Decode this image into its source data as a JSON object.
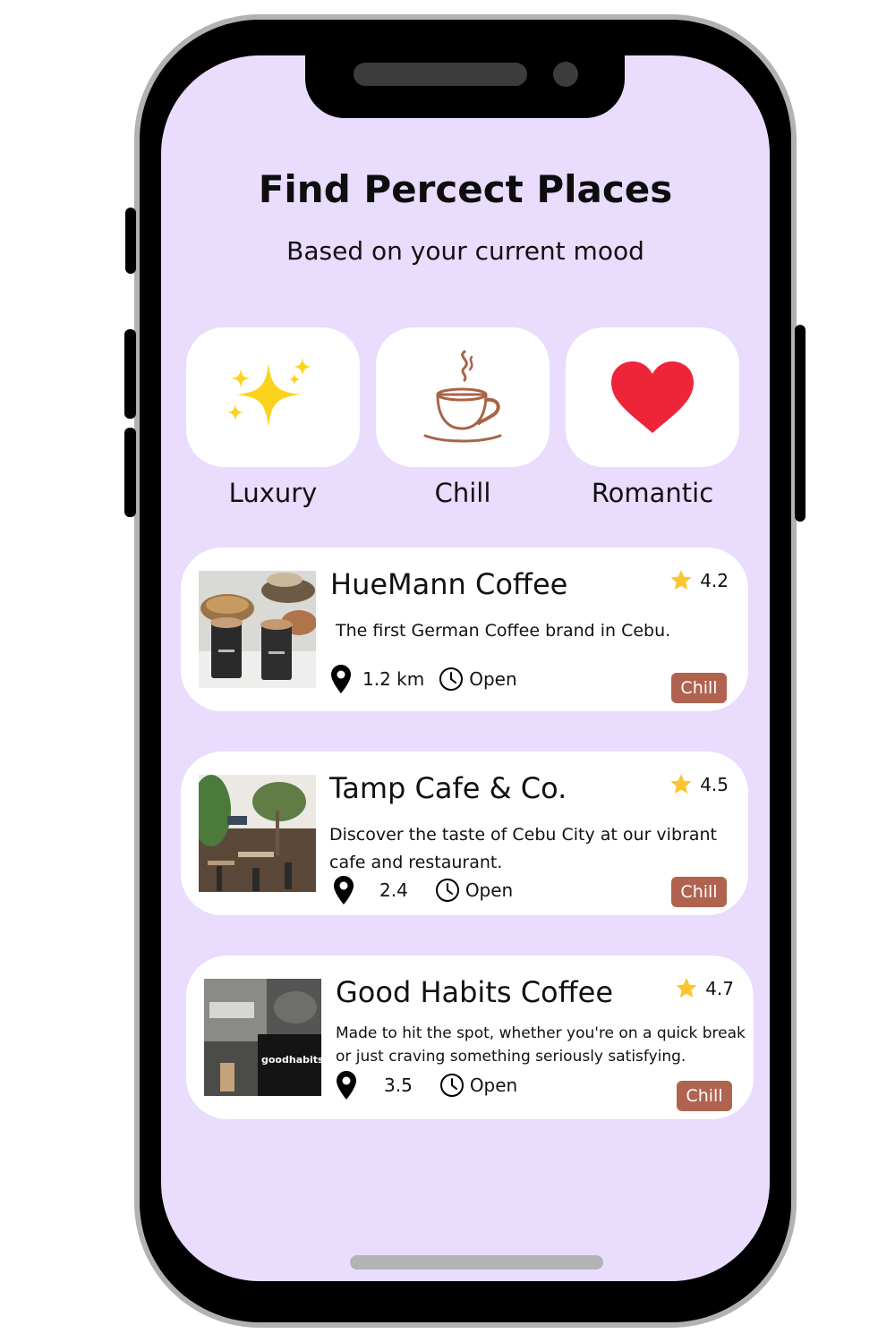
{
  "header": {
    "title": "Find Percect Places",
    "subtitle": "Based on your current mood"
  },
  "moods": [
    {
      "label": "Luxury",
      "icon": "sparkles-icon",
      "color": "#fbd21c"
    },
    {
      "label": "Chill",
      "icon": "coffee-cup-icon",
      "color": "#a86446"
    },
    {
      "label": "Romantic",
      "icon": "heart-icon",
      "color": "#ee2539"
    }
  ],
  "places": [
    {
      "name": "HueMann Coffee",
      "rating": "4.2",
      "description": "The first German Coffee brand in Cebu.",
      "distance": "1.2 km",
      "status": "Open",
      "tag": "Chill",
      "image": "two black coffee cups with pastries"
    },
    {
      "name": "Tamp Cafe & Co.",
      "rating": "4.5",
      "description": "Discover the taste of Cebu City at our vibrant cafe and restaurant.",
      "distance": "2.4",
      "status": "Open",
      "tag": "Chill",
      "image": "cafe interior with tree and tables"
    },
    {
      "name": "Good Habits Coffee",
      "rating": "4.7",
      "description": "Made to hit the spot, whether you're on a quick break or just craving something seriously satisfying.",
      "distance": "3.5",
      "status": "Open",
      "tag": "Chill",
      "image": "collage of cafe interior and goodhabits sign"
    }
  ],
  "colors": {
    "screen_background": "#e9dcfd",
    "tag_background": "#b0634f",
    "star": "#fbc62d"
  }
}
